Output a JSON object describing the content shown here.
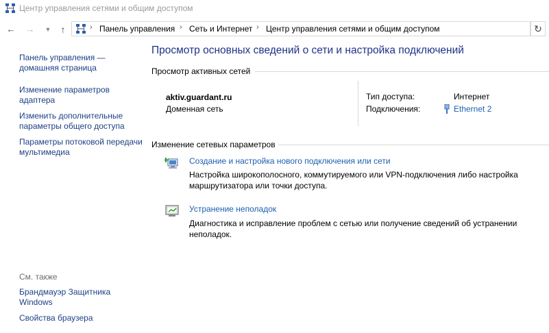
{
  "window": {
    "title": "Центр управления сетями и общим доступом"
  },
  "nav": {
    "back_icon": "back-arrow-icon",
    "forward_icon": "forward-arrow-icon",
    "up_icon": "up-arrow-icon",
    "refresh_icon": "refresh-icon"
  },
  "breadcrumb": [
    "Панель управления",
    "Сеть и Интернет",
    "Центр управления сетями и общим доступом"
  ],
  "sidebar": {
    "links": [
      "Панель управления — домашняя страница",
      "Изменение параметров адаптера",
      "Изменить дополнительные параметры общего доступа",
      "Параметры потоковой передачи мультимедиа"
    ],
    "see_also_title": "См. также",
    "see_also": [
      "Брандмауэр Защитника Windows",
      "Свойства браузера"
    ]
  },
  "main": {
    "heading": "Просмотр основных сведений о сети и настройка подключений",
    "active_networks": {
      "title": "Просмотр активных сетей",
      "network_name": "aktiv.guardant.ru",
      "network_type": "Доменная сеть",
      "access_type_label": "Тип доступа:",
      "access_type_value": "Интернет",
      "connections_label": "Подключения:",
      "connection_value": "Ethernet 2"
    },
    "change_settings": {
      "title": "Изменение сетевых параметров",
      "tasks": [
        {
          "icon": "new-connection-icon",
          "link": "Создание и настройка нового подключения или сети",
          "description": "Настройка широкополосного, коммутируемого или VPN-подключения либо настройка маршрутизатора или точки доступа."
        },
        {
          "icon": "troubleshoot-icon",
          "link": "Устранение неполадок",
          "description": "Диагностика и исправление проблем с сетью или получение сведений об устранении неполадок."
        }
      ]
    }
  },
  "colors": {
    "link": "#1c5fb0",
    "heading": "#1e3287",
    "sidebar_link": "#1c3f84"
  }
}
